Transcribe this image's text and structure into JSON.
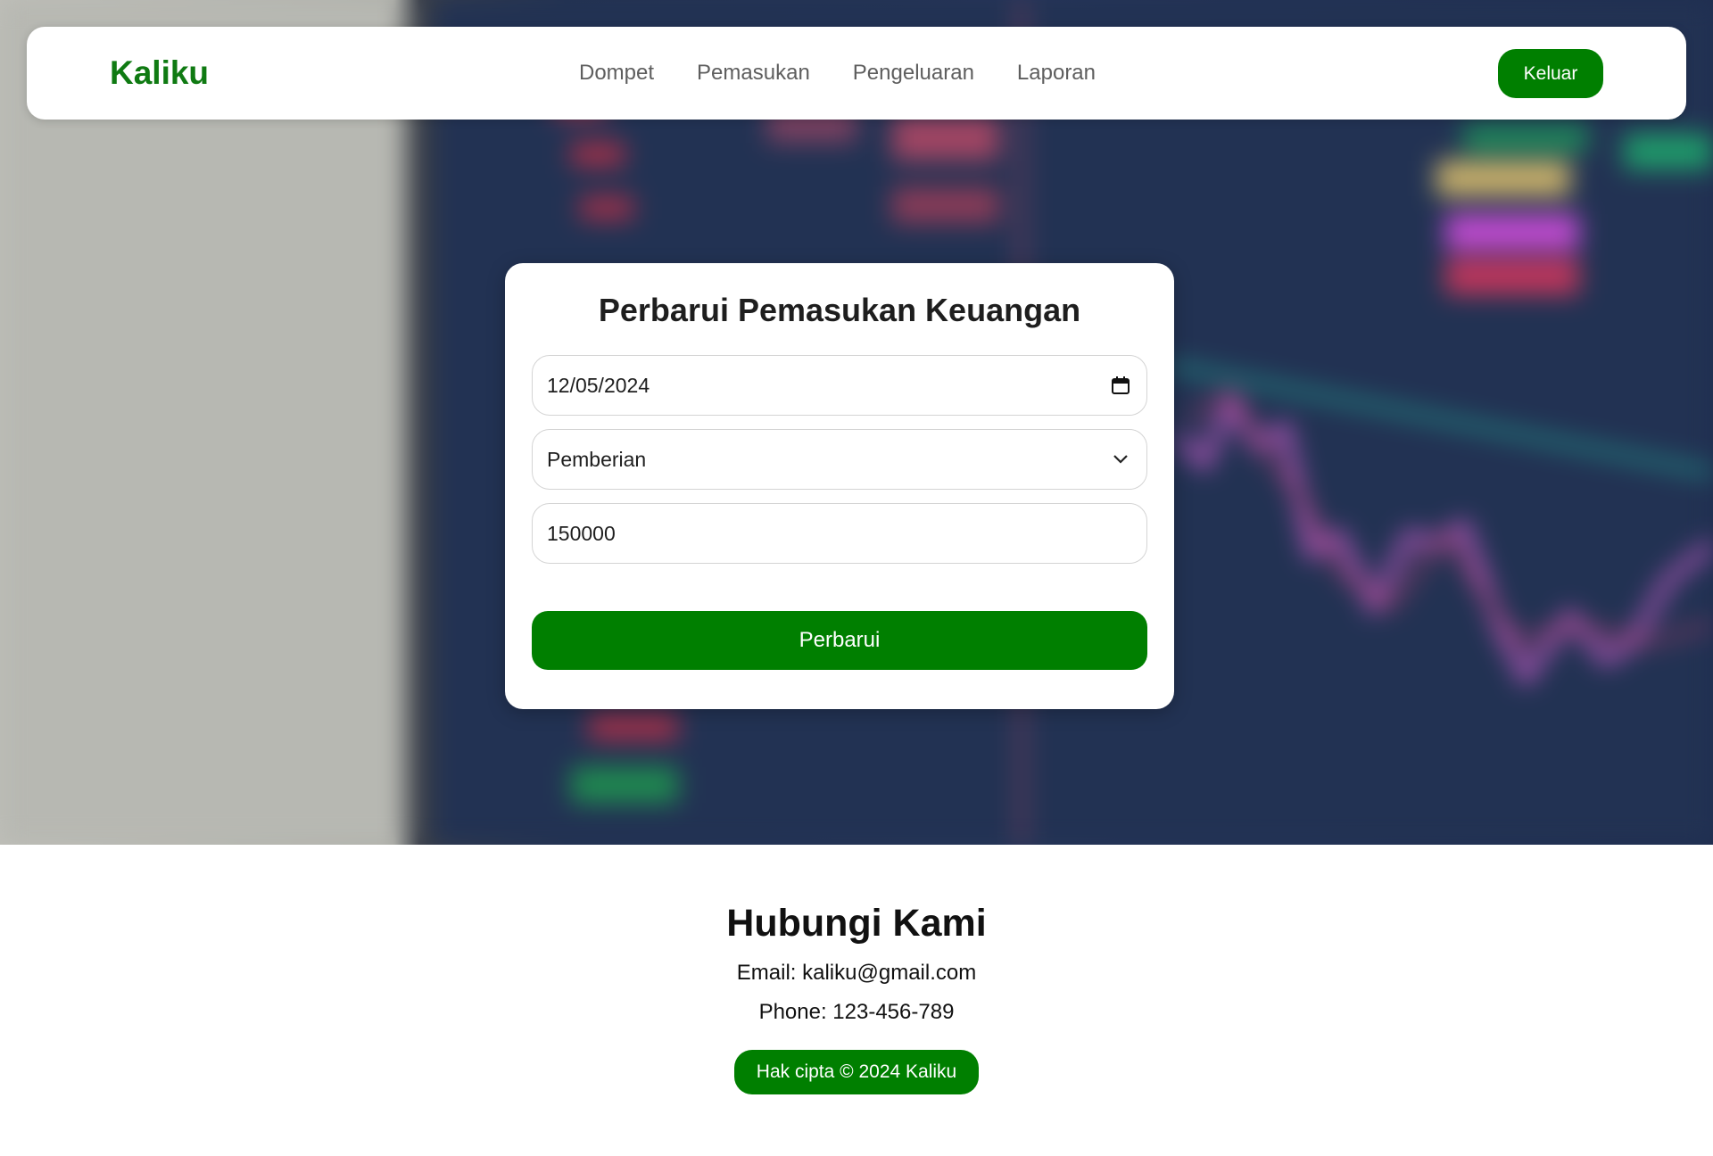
{
  "nav": {
    "brand": "Kaliku",
    "links": [
      "Dompet",
      "Pemasukan",
      "Pengeluaran",
      "Laporan"
    ],
    "logout_label": "Keluar"
  },
  "form": {
    "title": "Perbarui Pemasukan Keuangan",
    "date_value": "12/05/2024",
    "category_value": "Pemberian",
    "amount_value": "150000",
    "submit_label": "Perbarui"
  },
  "footer": {
    "title": "Hubungi Kami",
    "email": "Email: kaliku@gmail.com",
    "phone": "Phone: 123-456-789",
    "copyright": "Hak cipta © 2024 Kaliku"
  },
  "colors": {
    "accent": "#007f00",
    "brand": "#0f7a12"
  },
  "icons": {
    "date_field": "calendar-icon",
    "select_field": "chevron-down-icon"
  }
}
